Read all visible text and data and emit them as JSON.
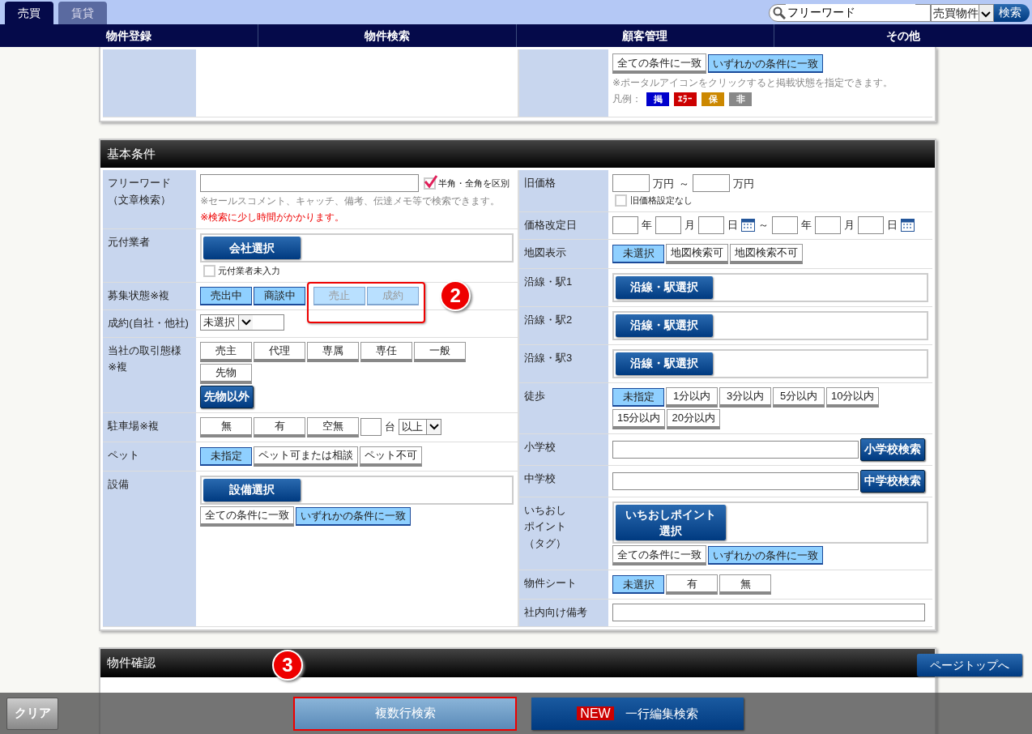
{
  "tabs": [
    {
      "label": "売買",
      "selected": true
    },
    {
      "label": "賃貸",
      "selected": false
    }
  ],
  "header_search": {
    "value": "フリーワード",
    "category": "売買物件",
    "button": "検索"
  },
  "nav": [
    "物件登録",
    "物件検索",
    "顧客管理",
    "その他"
  ],
  "sections": [
    {
      "right": [
        {
          "lines": [
            [
              {
                "kind": "toggle",
                "label": "全ての条件に一致",
                "selected": false
              },
              {
                "kind": "toggle",
                "label": "いずれかの条件に一致",
                "selected": true
              }
            ],
            [
              {
                "kind": "note",
                "text": "※ポータルアイコンをクリックすると掲載状態を指定できます。"
              }
            ],
            [
              {
                "kind": "legend",
                "label": "凡例：",
                "items": [
                  {
                    "text": "掲",
                    "color": "#0000cc"
                  },
                  {
                    "text": "ｴﾗｰ",
                    "color": "#cc0000"
                  },
                  {
                    "text": "保",
                    "color": "#cc8800"
                  },
                  {
                    "text": "非",
                    "color": "#888888"
                  }
                ]
              }
            ]
          ]
        }
      ]
    },
    {
      "title": "基本条件",
      "left": [
        {
          "label": [
            "フリーワード",
            "（文章検索）"
          ],
          "lines": [
            [
              {
                "kind": "wide_input"
              },
              {
                "kind": "checkbox",
                "label": "半角・全角を区別",
                "checked": true
              }
            ],
            [
              {
                "kind": "note",
                "text": "※セールスコメント、キャッチ、備考、伝達メモ等で検索できます。"
              }
            ],
            [
              {
                "kind": "warning",
                "text": "※検索に少し時間がかかります。"
              }
            ]
          ]
        },
        {
          "label": "元付業者",
          "lines": [
            [
              {
                "kind": "panel",
                "items": [
                  {
                    "kind": "action",
                    "label": "会社選択"
                  }
                ]
              }
            ],
            [
              {
                "kind": "checkbox",
                "label": "元付業者未入力",
                "checked": false
              }
            ]
          ]
        },
        {
          "label": "募集状態※複",
          "lines": [
            [
              {
                "kind": "toggle",
                "label": "売出中",
                "selected": true,
                "disabled": false
              },
              {
                "kind": "toggle",
                "label": "商談中",
                "selected": true,
                "disabled": false
              },
              {
                "kind": "group",
                "marker": "2",
                "items": [
                  {
                    "kind": "toggle",
                    "label": "売止",
                    "selected": true,
                    "disabled": true
                  },
                  {
                    "kind": "toggle",
                    "label": "成約",
                    "selected": true,
                    "disabled": true
                  }
                ]
              }
            ]
          ]
        },
        {
          "label": "成約(自社・他社)",
          "lines": [
            [
              {
                "kind": "dropdown",
                "value": "未選択"
              }
            ]
          ]
        },
        {
          "label": [
            "当社の取引態様",
            "※複"
          ],
          "lines": [
            [
              {
                "kind": "toggle",
                "label": "売主",
                "selected": false
              },
              {
                "kind": "toggle",
                "label": "代理",
                "selected": false
              },
              {
                "kind": "toggle",
                "label": "専属",
                "selected": false
              },
              {
                "kind": "toggle",
                "label": "専任",
                "selected": false
              },
              {
                "kind": "toggle",
                "label": "一般",
                "selected": false
              }
            ],
            [
              {
                "kind": "toggle",
                "label": "先物",
                "selected": false
              }
            ],
            [
              {
                "kind": "search_button",
                "label": "先物以外"
              }
            ]
          ]
        },
        {
          "label": "駐車場※複",
          "lines": [
            [
              {
                "kind": "toggle",
                "label": "無",
                "selected": false
              },
              {
                "kind": "toggle",
                "label": "有",
                "selected": false
              },
              {
                "kind": "toggle",
                "label": "空無",
                "selected": false
              },
              {
                "kind": "count_input"
              },
              {
                "kind": "text",
                "text": "台"
              },
              {
                "kind": "dropdown",
                "value": "以上"
              }
            ]
          ]
        },
        {
          "label": "ペット",
          "lines": [
            [
              {
                "kind": "toggle",
                "label": "未指定",
                "selected": true
              },
              {
                "kind": "toggle",
                "label": "ペット可または相談",
                "selected": false
              },
              {
                "kind": "toggle",
                "label": "ペット不可",
                "selected": false
              }
            ]
          ]
        },
        {
          "label": "設備",
          "lines": [
            [
              {
                "kind": "panel",
                "items": [
                  {
                    "kind": "action",
                    "label": "設備選択"
                  }
                ]
              }
            ],
            [
              {
                "kind": "toggle",
                "label": "全ての条件に一致",
                "selected": false
              },
              {
                "kind": "toggle",
                "label": "いずれかの条件に一致",
                "selected": true
              }
            ]
          ]
        }
      ],
      "right": [
        {
          "label": "旧価格",
          "lines": [
            [
              {
                "kind": "price_input"
              },
              {
                "kind": "text",
                "text": "万円"
              },
              {
                "kind": "text",
                "text": "～"
              },
              {
                "kind": "price_input"
              },
              {
                "kind": "text",
                "text": "万円"
              }
            ],
            [
              {
                "kind": "checkbox",
                "label": "旧価格設定なし",
                "checked": false
              }
            ]
          ]
        },
        {
          "label": "価格改定日",
          "lines": [
            [
              {
                "kind": "date_input"
              },
              {
                "kind": "text",
                "text": "年"
              },
              {
                "kind": "date_input"
              },
              {
                "kind": "text",
                "text": "月"
              },
              {
                "kind": "date_input"
              },
              {
                "kind": "text",
                "text": "日"
              },
              {
                "kind": "calendar"
              },
              {
                "kind": "text",
                "text": "～"
              },
              {
                "kind": "date_input"
              },
              {
                "kind": "text",
                "text": "年"
              },
              {
                "kind": "date_input"
              },
              {
                "kind": "text",
                "text": "月"
              },
              {
                "kind": "date_input"
              },
              {
                "kind": "text",
                "text": "日"
              },
              {
                "kind": "calendar"
              }
            ]
          ]
        },
        {
          "label": "地図表示",
          "lines": [
            [
              {
                "kind": "toggle",
                "label": "未選択",
                "selected": true
              },
              {
                "kind": "toggle",
                "label": "地図検索可",
                "selected": false
              },
              {
                "kind": "toggle",
                "label": "地図検索不可",
                "selected": false
              }
            ]
          ]
        },
        {
          "label": "沿線・駅1",
          "lines": [
            [
              {
                "kind": "panel",
                "items": [
                  {
                    "kind": "action",
                    "label": "沿線・駅選択"
                  }
                ]
              }
            ]
          ]
        },
        {
          "label": "沿線・駅2",
          "lines": [
            [
              {
                "kind": "panel",
                "items": [
                  {
                    "kind": "action",
                    "label": "沿線・駅選択"
                  }
                ]
              }
            ]
          ]
        },
        {
          "label": "沿線・駅3",
          "lines": [
            [
              {
                "kind": "panel",
                "items": [
                  {
                    "kind": "action",
                    "label": "沿線・駅選択"
                  }
                ]
              }
            ]
          ]
        },
        {
          "label": "徒歩",
          "lines": [
            [
              {
                "kind": "toggle",
                "label": "未指定",
                "selected": true
              },
              {
                "kind": "toggle",
                "label": "1分以内",
                "selected": false
              },
              {
                "kind": "toggle",
                "label": "3分以内",
                "selected": false
              },
              {
                "kind": "toggle",
                "label": "5分以内",
                "selected": false
              },
              {
                "kind": "toggle",
                "label": "10分以内",
                "selected": false
              }
            ],
            [
              {
                "kind": "toggle",
                "label": "15分以内",
                "selected": false
              },
              {
                "kind": "toggle",
                "label": "20分以内",
                "selected": false
              }
            ]
          ]
        },
        {
          "label": "小学校",
          "lines": [
            [
              {
                "kind": "school_input"
              },
              {
                "kind": "search_button",
                "label": "小学校検索"
              }
            ]
          ]
        },
        {
          "label": "中学校",
          "lines": [
            [
              {
                "kind": "school_input"
              },
              {
                "kind": "search_button",
                "label": "中学校検索"
              }
            ]
          ]
        },
        {
          "label": [
            "いちおし",
            "ポイント",
            "（タグ）"
          ],
          "lines": [
            [
              {
                "kind": "panel",
                "items": [
                  {
                    "kind": "action",
                    "label": "いちおしポイント選択"
                  }
                ]
              }
            ],
            [
              {
                "kind": "toggle",
                "label": "全ての条件に一致",
                "selected": false
              },
              {
                "kind": "toggle",
                "label": "いずれかの条件に一致",
                "selected": true
              }
            ]
          ]
        },
        {
          "label": "物件シート",
          "lines": [
            [
              {
                "kind": "toggle",
                "label": "未選択",
                "selected": true
              },
              {
                "kind": "toggle",
                "label": "有",
                "selected": false
              },
              {
                "kind": "toggle",
                "label": "無",
                "selected": false
              }
            ]
          ]
        },
        {
          "label": "社内向け備考",
          "lines": [
            [
              {
                "kind": "full_input"
              }
            ]
          ]
        }
      ]
    },
    {
      "title": "物件確認"
    }
  ],
  "page_top": "ページトップへ",
  "bottom_bar": [
    {
      "kind": "clear",
      "label": "クリア",
      "highlight": false
    },
    {
      "kind": "multi",
      "label": "複数行検索",
      "highlight": true,
      "marker": "3"
    },
    {
      "kind": "single",
      "label": "一行編集検索",
      "badge": "NEW",
      "highlight": false
    }
  ]
}
